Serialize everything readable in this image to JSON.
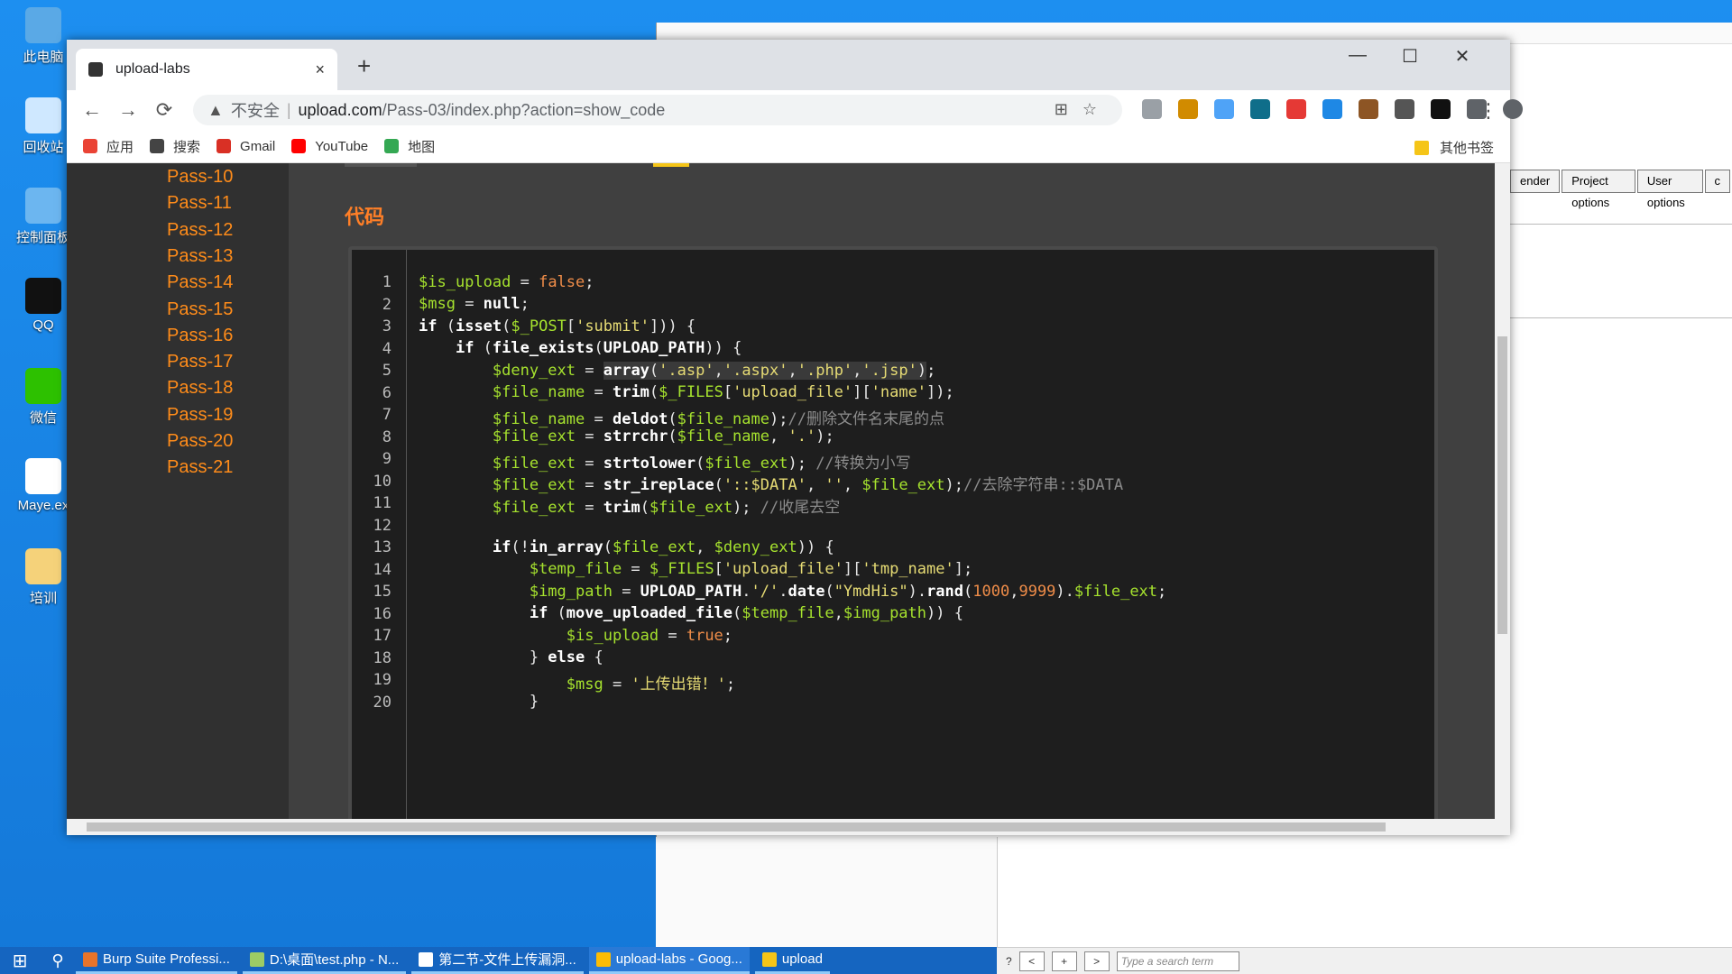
{
  "desktop": {
    "icons": [
      {
        "label": "此电脑",
        "color": "#5aa9e6"
      },
      {
        "label": "回收站",
        "color": "#cfe8ff"
      },
      {
        "label": "控制面板",
        "color": "#6cb6f0"
      },
      {
        "label": "QQ",
        "color": "#111111"
      },
      {
        "label": "微信",
        "color": "#2dc100"
      },
      {
        "label": "Maye.ex",
        "color": "#ffffff"
      },
      {
        "label": "培训",
        "color": "#f5d27a"
      }
    ]
  },
  "background_window": {
    "burp_tabs": [
      "ender",
      "Project options",
      "User options",
      "c"
    ],
    "bottom_search_placeholder": "Type a search term",
    "nav_buttons": [
      "<",
      "+",
      ">"
    ],
    "help": "?"
  },
  "browser": {
    "tab_title": "upload-labs",
    "tab_close": "×",
    "new_tab": "+",
    "window_controls": [
      "—",
      "☐",
      "✕"
    ],
    "nav": {
      "back": "←",
      "forward": "→",
      "reload": "⟳"
    },
    "omnibox": {
      "security_icon": "▲",
      "not_secure": "不安全",
      "separator": "|",
      "domain": "upload.com",
      "path": "/Pass-03/index.php?action=show_code",
      "right_icons": "⊞☆"
    },
    "menu_icon": "⋮",
    "extension_colors": [
      "#9aa0a6",
      "#d18b00",
      "#4fa3f7",
      "#0f6e8a",
      "#e53935",
      "#1e88e5",
      "#8d5524",
      "#555555",
      "#111111",
      "#5f6368",
      "#5f6368"
    ],
    "bookmarks": [
      {
        "label": "应用",
        "color": "#ea4335"
      },
      {
        "label": "搜索",
        "color": "#444444"
      },
      {
        "label": "Gmail",
        "color": "#d93025"
      },
      {
        "label": "YouTube",
        "color": "#ff0000"
      },
      {
        "label": "地图",
        "color": "#34a853"
      }
    ],
    "other_bookmarks": "其他书签"
  },
  "page": {
    "passes": [
      "Pass-10",
      "Pass-11",
      "Pass-12",
      "Pass-13",
      "Pass-14",
      "Pass-15",
      "Pass-16",
      "Pass-17",
      "Pass-18",
      "Pass-19",
      "Pass-20",
      "Pass-21"
    ],
    "code_title": "代码",
    "line_numbers": [
      "1",
      "2",
      "3",
      "4",
      "5",
      "6",
      "7",
      "8",
      "9",
      "10",
      "11",
      "12",
      "13",
      "14",
      "15",
      "16",
      "17",
      "18",
      "19",
      "20"
    ]
  },
  "taskbar": {
    "start": "⊞",
    "search": "⚲",
    "items": [
      {
        "label": "Burp Suite Professi...",
        "color": "#e8742a"
      },
      {
        "label": "D:\\桌面\\test.php - N...",
        "color": "#9ccc65"
      },
      {
        "label": "第二节-文件上传漏洞...",
        "color": "#ffffff"
      },
      {
        "label": "upload-labs - Goog...",
        "color": "#fbbc05"
      },
      {
        "label": "upload",
        "color": "#f5c518"
      }
    ]
  }
}
